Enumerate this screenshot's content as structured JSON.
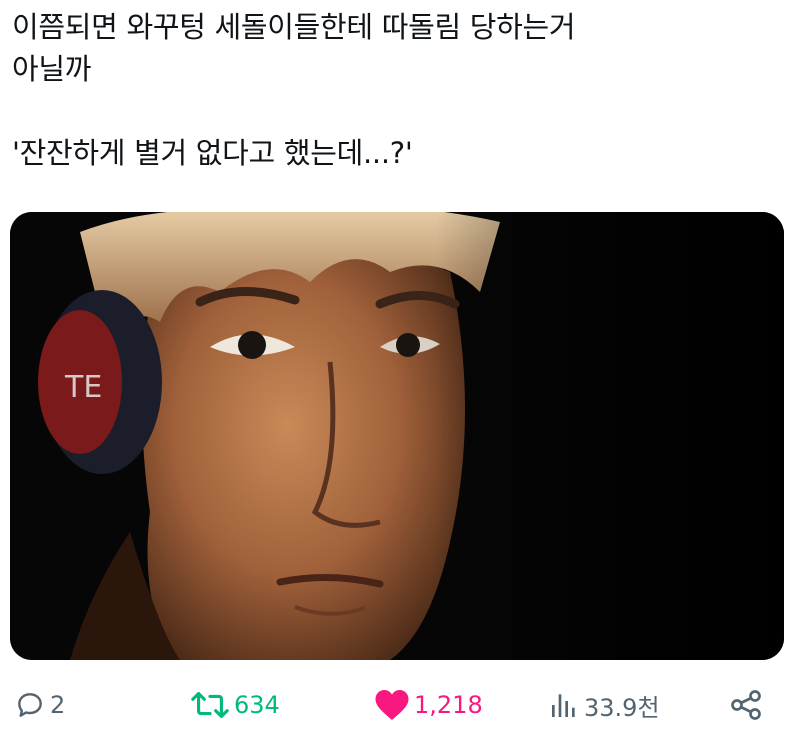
{
  "tweet": {
    "text": "이쯤되면 와꾸텅 세돌이들한테 따돌림 당하는거\n아닐까\n\n'잔잔하게 별거 없다고 했는데...?'"
  },
  "media": {
    "headphone_text": "TE"
  },
  "actions": {
    "reply_count": "2",
    "retweet_count": "634",
    "like_count": "1,218",
    "views_count": "33.9천"
  },
  "colors": {
    "retweet": "#00ba7c",
    "like": "#f91880",
    "muted": "#536471"
  }
}
